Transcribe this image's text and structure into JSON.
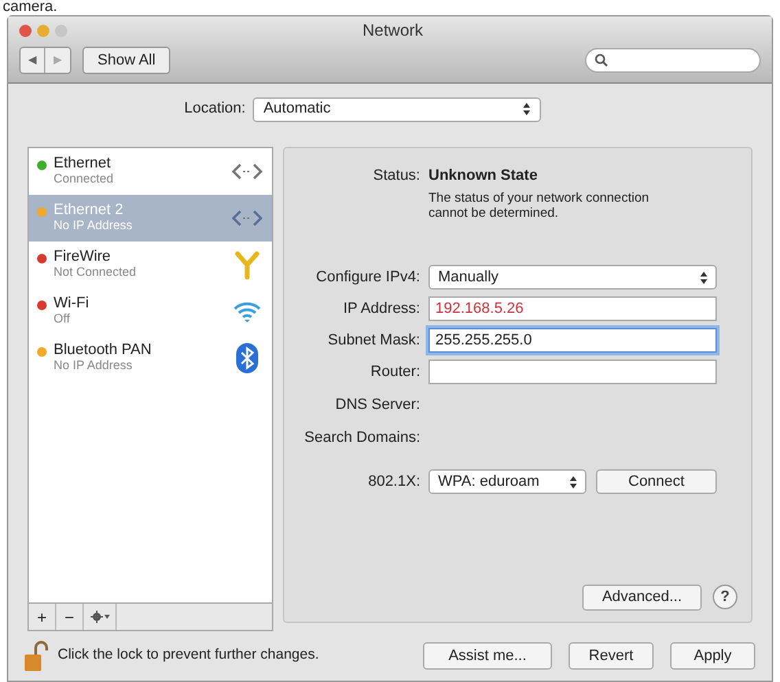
{
  "caption": "camera.",
  "window": {
    "title": "Network"
  },
  "toolbar": {
    "back": "◀",
    "forward": "▶",
    "show_all": "Show All"
  },
  "location": {
    "label": "Location:",
    "value": "Automatic"
  },
  "services": [
    {
      "name": "Ethernet",
      "status": "Connected",
      "color": "#3fae2a",
      "selected": false,
      "kind": "ethernet"
    },
    {
      "name": "Ethernet 2",
      "status": "No IP Address",
      "color": "#f0a92a",
      "selected": true,
      "kind": "ethernet"
    },
    {
      "name": "FireWire",
      "status": "Not Connected",
      "color": "#d83a2e",
      "selected": false,
      "kind": "firewire"
    },
    {
      "name": "Wi-Fi",
      "status": "Off",
      "color": "#d83a2e",
      "selected": false,
      "kind": "wifi"
    },
    {
      "name": "Bluetooth PAN",
      "status": "No IP Address",
      "color": "#f0a92a",
      "selected": false,
      "kind": "bluetooth"
    }
  ],
  "list_buttons": [
    "+",
    "−"
  ],
  "status": {
    "label": "Status:",
    "value": "Unknown State",
    "description": "The status of your network connection cannot be determined."
  },
  "fields": [
    {
      "label": "Configure IPv4:",
      "kind": "select",
      "value": "Manually"
    },
    {
      "label": "IP Address:",
      "kind": "input",
      "value": "192.168.5.26",
      "invalid": true,
      "focused": false
    },
    {
      "label": "Subnet Mask:",
      "kind": "input",
      "value": "255.255.255.0",
      "invalid": false,
      "focused": true
    },
    {
      "label": "Router:",
      "kind": "input",
      "focused": false
    },
    {
      "label": "DNS Server:",
      "kind": "text"
    },
    {
      "label": "Search Domains:",
      "kind": "text"
    }
  ],
  "dot1x": {
    "label": "802.1X:",
    "value": "WPA: eduroam",
    "button": "Connect"
  },
  "advanced": "Advanced...",
  "help": "?",
  "lock_text": "Click the lock to prevent further changes.",
  "buttons": [
    "Assist me...",
    "Revert",
    "Apply"
  ]
}
